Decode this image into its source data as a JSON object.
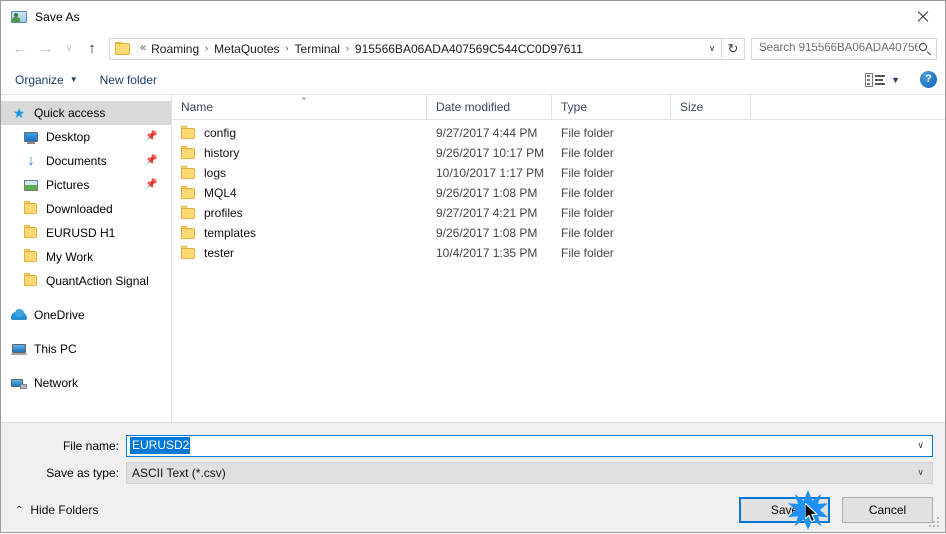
{
  "window": {
    "title": "Save As",
    "icon": "save-as-folder-icon",
    "close_label": "×"
  },
  "navbar": {
    "back_icon": "←",
    "forward_icon": "→",
    "recent_icon": "∨",
    "up_icon": "↑",
    "refresh_icon": "↻",
    "dropdown_icon": "∨",
    "breadcrumb_prefix": "«",
    "breadcrumb": [
      "Roaming",
      "MetaQuotes",
      "Terminal",
      "915566BA06ADA407569C544CC0D97611"
    ],
    "separator": "›",
    "search_placeholder": "Search 915566BA06ADA40756..."
  },
  "commandbar": {
    "organize_label": "Organize",
    "organize_caret": "▼",
    "new_folder_label": "New folder",
    "view_caret": "▼",
    "help_label": "?"
  },
  "sidebar": {
    "items": [
      {
        "label": "Quick access",
        "icon": "star-icon",
        "selected": true,
        "indent": "root",
        "pinned": false
      },
      {
        "label": "Desktop",
        "icon": "desktop-icon",
        "selected": false,
        "indent": "child",
        "pinned": true
      },
      {
        "label": "Documents",
        "icon": "documents-icon",
        "selected": false,
        "indent": "child",
        "pinned": true
      },
      {
        "label": "Pictures",
        "icon": "pictures-icon",
        "selected": false,
        "indent": "child",
        "pinned": true
      },
      {
        "label": "Downloaded",
        "icon": "folder-icon",
        "selected": false,
        "indent": "child",
        "pinned": false
      },
      {
        "label": "EURUSD H1",
        "icon": "folder-icon",
        "selected": false,
        "indent": "child",
        "pinned": false
      },
      {
        "label": "My Work",
        "icon": "folder-icon",
        "selected": false,
        "indent": "child",
        "pinned": false
      },
      {
        "label": "QuantAction Signal",
        "icon": "folder-icon",
        "selected": false,
        "indent": "child",
        "pinned": false
      },
      {
        "label": "OneDrive",
        "icon": "onedrive-icon",
        "selected": false,
        "indent": "root",
        "pinned": false,
        "gap_before": true
      },
      {
        "label": "This PC",
        "icon": "this-pc-icon",
        "selected": false,
        "indent": "root",
        "pinned": false,
        "gap_before": true
      },
      {
        "label": "Network",
        "icon": "network-icon",
        "selected": false,
        "indent": "root",
        "pinned": false,
        "gap_before": true
      }
    ],
    "pin_glyph": "📌"
  },
  "filelist": {
    "columns": [
      "Name",
      "Date modified",
      "Type",
      "Size"
    ],
    "sort_caret": "⌃",
    "rows": [
      {
        "name": "config",
        "date": "9/27/2017 4:44 PM",
        "type": "File folder",
        "size": ""
      },
      {
        "name": "history",
        "date": "9/26/2017 10:17 PM",
        "type": "File folder",
        "size": ""
      },
      {
        "name": "logs",
        "date": "10/10/2017 1:17 PM",
        "type": "File folder",
        "size": ""
      },
      {
        "name": "MQL4",
        "date": "9/26/2017 1:08 PM",
        "type": "File folder",
        "size": ""
      },
      {
        "name": "profiles",
        "date": "9/27/2017 4:21 PM",
        "type": "File folder",
        "size": ""
      },
      {
        "name": "templates",
        "date": "9/26/2017 1:08 PM",
        "type": "File folder",
        "size": ""
      },
      {
        "name": "tester",
        "date": "10/4/2017 1:35 PM",
        "type": "File folder",
        "size": ""
      }
    ]
  },
  "form": {
    "filename_label": "File name:",
    "filename_value": "EURUSD2",
    "filetype_label": "Save as type:",
    "filetype_value": "ASCII Text (*.csv)",
    "combo_arrow": "∨"
  },
  "footer": {
    "hide_folders_label": "Hide Folders",
    "hide_folders_caret": "⌃",
    "save_label": "Save",
    "cancel_label": "Cancel"
  },
  "colors": {
    "accent": "#0078d7",
    "folder_yellow": "#fcd975",
    "dialog_bg": "#f0f0f0",
    "selection_bg": "#d9d9d9"
  }
}
